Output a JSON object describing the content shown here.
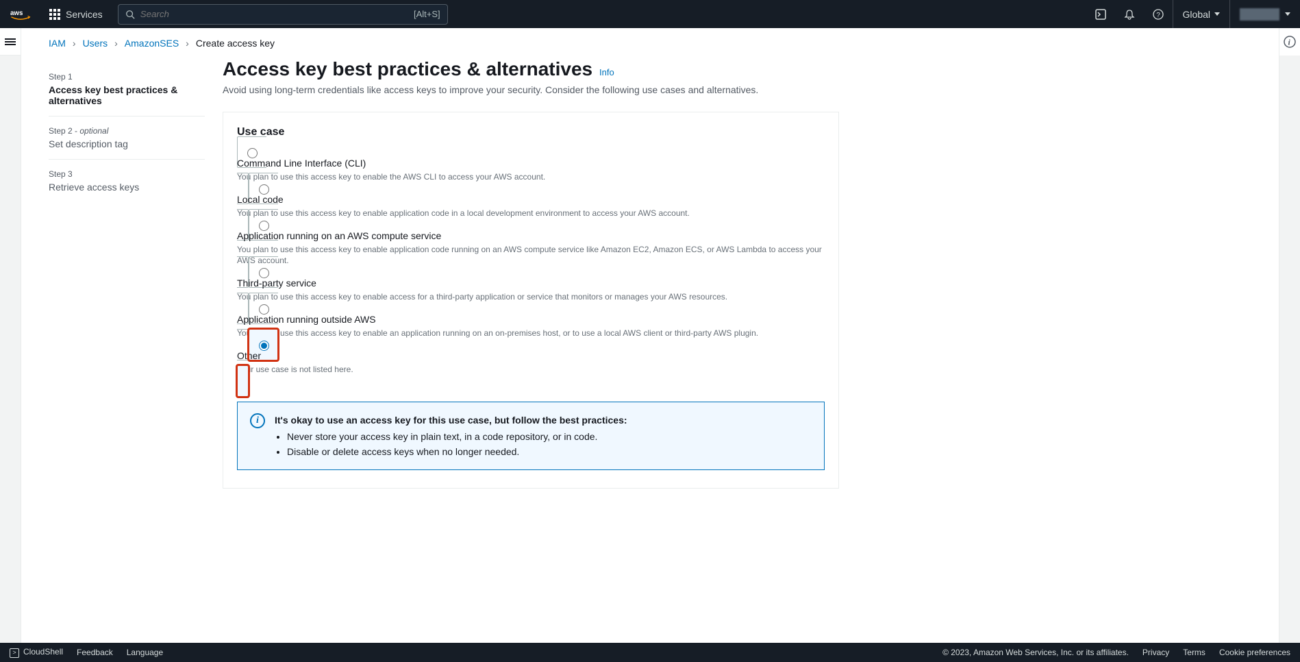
{
  "topnav": {
    "services_label": "Services",
    "search_placeholder": "Search",
    "search_shortcut": "[Alt+S]",
    "region": "Global"
  },
  "breadcrumb": {
    "iam": "IAM",
    "users": "Users",
    "user": "AmazonSES",
    "current": "Create access key"
  },
  "steps": {
    "s1_num": "Step 1",
    "s1_title": "Access key best practices & alternatives",
    "s2_num": "Step 2 - ",
    "s2_opt": "optional",
    "s2_title": "Set description tag",
    "s3_num": "Step 3",
    "s3_title": "Retrieve access keys"
  },
  "page": {
    "title": "Access key best practices & alternatives",
    "info": "Info",
    "subtitle": "Avoid using long-term credentials like access keys to improve your security. Consider the following use cases and alternatives."
  },
  "panel_title": "Use case",
  "tiles": [
    {
      "title": "Command Line Interface (CLI)",
      "desc": "You plan to use this access key to enable the AWS CLI to access your AWS account."
    },
    {
      "title": "Local code",
      "desc": "You plan to use this access key to enable application code in a local development environment to access your AWS account."
    },
    {
      "title": "Application running on an AWS compute service",
      "desc": "You plan to use this access key to enable application code running on an AWS compute service like Amazon EC2, Amazon ECS, or AWS Lambda to access your AWS account."
    },
    {
      "title": "Third-party service",
      "desc": "You plan to use this access key to enable access for a third-party application or service that monitors or manages your AWS resources."
    },
    {
      "title": "Application running outside AWS",
      "desc": "You plan to use this access key to enable an application running on an on-premises host, or to use a local AWS client or third-party AWS plugin."
    },
    {
      "title": "Other",
      "desc": "Your use case is not listed here."
    }
  ],
  "info_box": {
    "title": "It's okay to use an access key for this use case, but follow the best practices:",
    "bullets": [
      "Never store your access key in plain text, in a code repository, or in code.",
      "Disable or delete access keys when no longer needed."
    ]
  },
  "footer": {
    "cloudshell": "CloudShell",
    "feedback": "Feedback",
    "language": "Language",
    "copyright": "© 2023, Amazon Web Services, Inc. or its affiliates.",
    "privacy": "Privacy",
    "terms": "Terms",
    "cookies": "Cookie preferences"
  }
}
